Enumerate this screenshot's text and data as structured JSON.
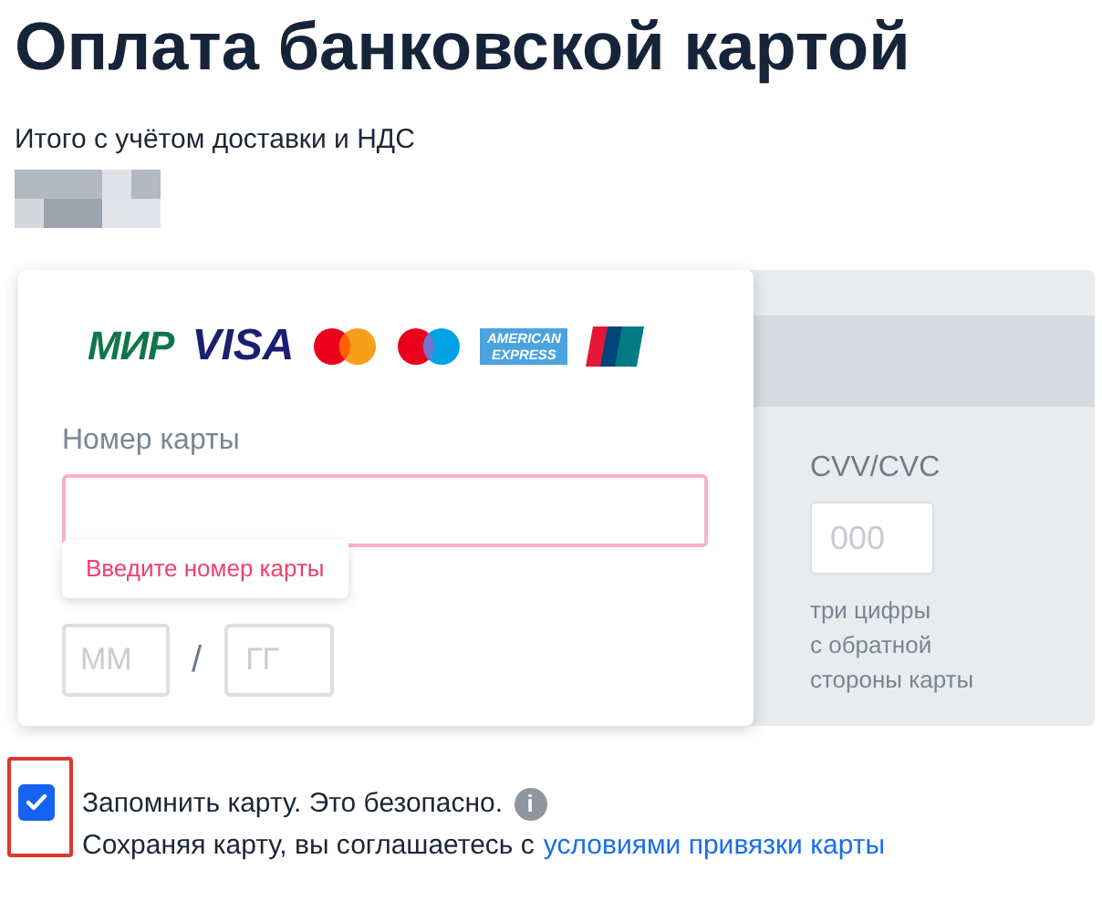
{
  "title": "Оплата банковской картой",
  "total_label": "Итого с учётом доставки и НДС",
  "payment_logos": [
    {
      "kind": "mir",
      "text": "МИР"
    },
    {
      "kind": "visa",
      "text": "VISA"
    },
    {
      "kind": "mastercard"
    },
    {
      "kind": "maestro"
    },
    {
      "kind": "amex",
      "text": "AMERICAN EXPRESS"
    },
    {
      "kind": "unionpay"
    }
  ],
  "card_number": {
    "label": "Номер карты",
    "error": "Введите номер карты"
  },
  "expiry": {
    "month_placeholder": "ММ",
    "separator": "/",
    "year_placeholder": "ГГ"
  },
  "cvv": {
    "label": "CVV/CVC",
    "placeholder": "000",
    "hint_lines": [
      "три цифры",
      "с обратной",
      "стороны карты"
    ]
  },
  "remember": {
    "checked": true,
    "label": "Запомнить карту. Это безопасно.",
    "info_icon": "i",
    "consent": "Сохраняя карту, вы соглашаетесь с",
    "link": "условиями привязки карты"
  }
}
